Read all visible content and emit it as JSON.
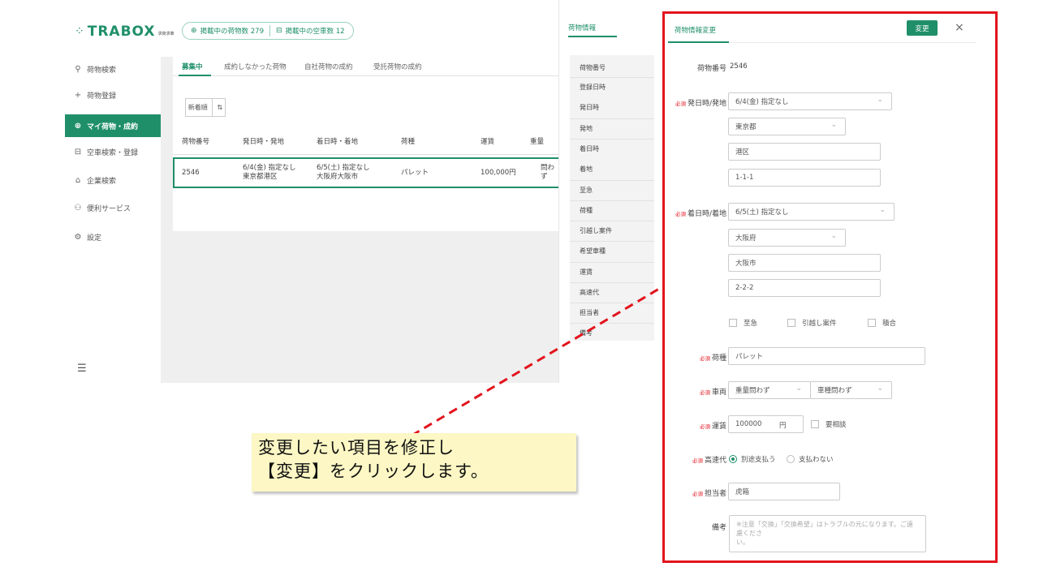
{
  "header": {
    "logo_text": "TRABOX",
    "logo_sub": "求荷求車",
    "cargo_count": "掲載中の荷物数 279",
    "truck_count": "掲載中の空車数 12"
  },
  "sidebar": {
    "items": [
      {
        "label": "荷物検索",
        "icon": "search-icon"
      },
      {
        "label": "荷物登録",
        "icon": "plus-icon"
      },
      {
        "label": "マイ荷物・成約",
        "icon": "box-icon"
      },
      {
        "label": "空車検索・登録",
        "icon": "truck-icon"
      },
      {
        "label": "企業検索",
        "icon": "building-icon"
      },
      {
        "label": "便利サービス",
        "icon": "service-icon"
      },
      {
        "label": "設定",
        "icon": "gear-icon"
      }
    ]
  },
  "tabs": [
    "募集中",
    "成約しなかった荷物",
    "自社荷物の成約",
    "受託荷物の成約"
  ],
  "sort": {
    "label": "新着順",
    "icon": "sort-icon"
  },
  "table": {
    "headers": [
      "荷物番号",
      "発日時・発地",
      "着日時・着地",
      "荷種",
      "運賃",
      "重量"
    ],
    "row": {
      "id": "2546",
      "departure_1": "6/4(金) 指定なし",
      "departure_2": "東京都港区",
      "arrival_1": "6/5(土) 指定なし",
      "arrival_2": "大阪府大阪市",
      "cargo": "パレット",
      "fare": "100,000円",
      "weight_1": "問わ",
      "weight_2": "ず"
    }
  },
  "info": {
    "title": "荷物情報",
    "items": [
      "荷物番号",
      "登録日時",
      "発日時",
      "発地",
      "着日時",
      "着地",
      "至急",
      "荷種",
      "引越し案件",
      "希望車種",
      "運賃",
      "高速代",
      "担当者",
      "備考"
    ]
  },
  "form": {
    "title": "荷物情報変更",
    "change_label": "変更",
    "close_label": "×",
    "required": "必須",
    "id_label": "荷物番号",
    "id_value": "2546",
    "dep_label": "発日時/発地",
    "dep_date": "6/4(金) 指定なし",
    "dep_pref": "東京都",
    "dep_city": "港区",
    "dep_addr": "1-1-1",
    "arr_label": "着日時/着地",
    "arr_date": "6/5(土) 指定なし",
    "arr_pref": "大阪府",
    "arr_city": "大阪市",
    "arr_addr": "2-2-2",
    "opt_urgent": "至急",
    "opt_moving": "引越し案件",
    "opt_mixed": "積合",
    "cargo_label": "荷種",
    "cargo_value": "パレット",
    "vehicle_label": "車両",
    "vehicle_weight": "重量問わず",
    "vehicle_type": "車種問わず",
    "fare_label": "運賃",
    "fare_value": "100000",
    "fare_unit": "円",
    "fare_consult": "要相談",
    "highway_label": "高速代",
    "highway_opt1": "別途支払う",
    "highway_opt2": "支払わない",
    "person_label": "担当者",
    "person_value": "虎箱",
    "memo_label": "備考",
    "memo_placeholder_1": "※注意「交換」「交換希望」はトラブルの元になります。ご遠慮くださ",
    "memo_placeholder_2": "い。"
  },
  "callout": {
    "line1": "変更したい項目を修正し",
    "line2": "【変更】をクリックします。"
  },
  "colors": {
    "brand": "#1f8f6a",
    "highlight": "#e2141d",
    "callout_bg": "#fcf7c4"
  }
}
